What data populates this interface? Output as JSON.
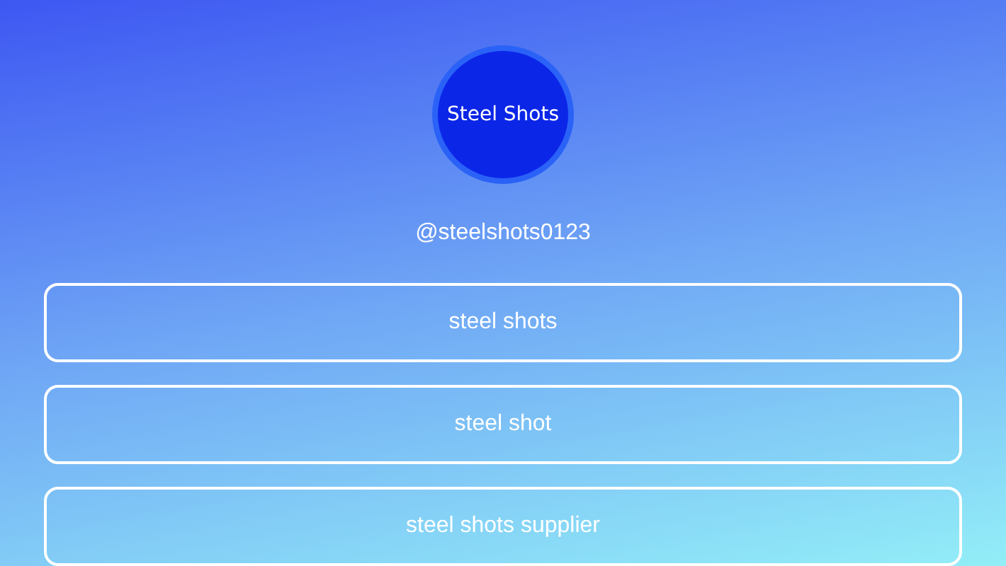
{
  "profile": {
    "avatar_text": "Steel Shots",
    "handle": "@steelshots0123"
  },
  "links": [
    {
      "label": "steel shots"
    },
    {
      "label": "steel shot"
    },
    {
      "label": "steel shots supplier"
    }
  ]
}
